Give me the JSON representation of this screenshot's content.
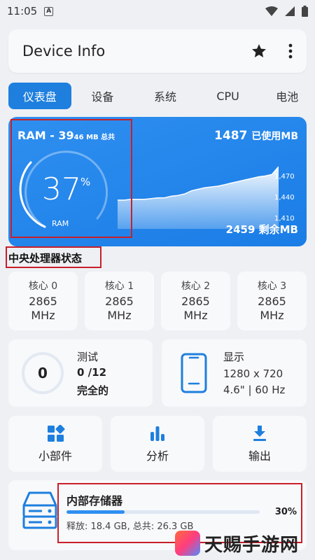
{
  "status_bar": {
    "time": "11:05",
    "a_label": "A"
  },
  "appbar": {
    "title": "Device Info"
  },
  "tabs": [
    {
      "label": "仪表盘"
    },
    {
      "label": "设备"
    },
    {
      "label": "系统"
    },
    {
      "label": "CPU"
    },
    {
      "label": "电池"
    }
  ],
  "ram": {
    "title_main": "RAM - 39",
    "title_small": "46 MB 总共",
    "percent_value": "37",
    "percent_sign": "%",
    "gauge_label": "RAM",
    "used_value": "1487",
    "used_unit": "已使用MB",
    "free_text": "2459 剩余MB",
    "ticks": [
      "1,470",
      "1,440",
      "1,410"
    ]
  },
  "chart_data": {
    "type": "area",
    "title": "",
    "ylim": [
      1400,
      1490
    ],
    "series": [
      {
        "values": [
          1437,
          1437,
          1438,
          1438,
          1438,
          1439,
          1440,
          1440,
          1442,
          1443,
          1445,
          1449,
          1451,
          1453,
          1454,
          1455,
          1457,
          1459,
          1461,
          1463,
          1465,
          1467,
          1468,
          1470,
          1480
        ]
      }
    ],
    "ticks": [
      1470,
      1440,
      1410
    ]
  },
  "cpu_section": {
    "title": "中央处理器状态"
  },
  "cores": [
    {
      "label": "核心 0",
      "value": "2865",
      "unit": "MHz"
    },
    {
      "label": "核心 1",
      "value": "2865",
      "unit": "MHz"
    },
    {
      "label": "核心 2",
      "value": "2865",
      "unit": "MHz"
    },
    {
      "label": "核心 3",
      "value": "2865",
      "unit": "MHz"
    }
  ],
  "test": {
    "circle_value": "0",
    "label": "测试",
    "count": "0 /12",
    "status": "完全的"
  },
  "display": {
    "label": "显示",
    "resolution": "1280 x 720",
    "size": "4.6\" | 60 Hz"
  },
  "actions": [
    {
      "label": "小部件",
      "icon": "widgets-icon"
    },
    {
      "label": "分析",
      "icon": "bar-chart-icon"
    },
    {
      "label": "输出",
      "icon": "download-icon"
    }
  ],
  "storage": {
    "title": "内部存储器",
    "percent_text": "30%",
    "fraction": 0.3,
    "detail": "释放: 18.4 GB,  总共: 26.3 GB"
  },
  "watermark": {
    "text": "天赐手游网"
  },
  "colors": {
    "accent": "#1e7fde",
    "annotation": "#c8202a",
    "background": "#eef0f4"
  }
}
